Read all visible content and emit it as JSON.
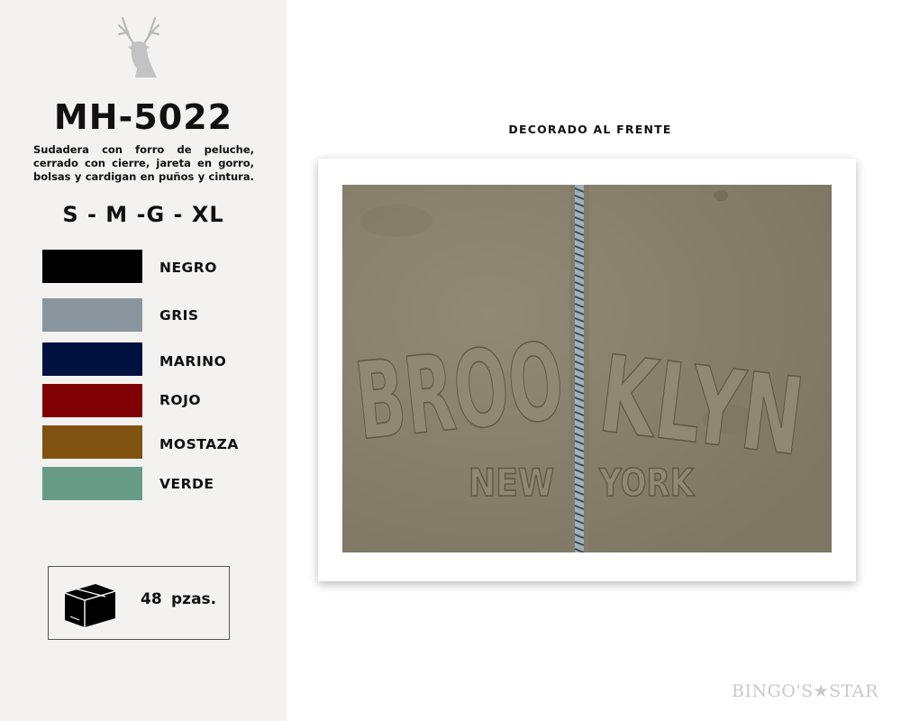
{
  "product": {
    "model": "MH-5022",
    "description": "Sudadera con forro de peluche, cerrado con cierre, jareta en gorro, bolsas y cardigan en puños y cintura.",
    "sizes": "S - M -G - XL"
  },
  "colors": [
    {
      "name": "NEGRO",
      "hex": "#000000"
    },
    {
      "name": "GRIS",
      "hex": "#8a959d"
    },
    {
      "name": "MARINO",
      "hex": "#011240"
    },
    {
      "name": "ROJO",
      "hex": "#800104"
    },
    {
      "name": "MOSTAZA",
      "hex": "#815311"
    },
    {
      "name": "VERDE",
      "hex": "#689b87"
    }
  ],
  "package": {
    "icon": "box-icon",
    "quantity": "48",
    "unit": "pzas."
  },
  "photo": {
    "label": "DECORADO AL FRENTE",
    "embossed_text_top": "BROOKLYN",
    "embossed_text_bottom": "NEW YORK",
    "fabric_color": "#8b8570"
  },
  "brand": {
    "logo_icon": "deer-head-icon",
    "name": "BINGO'S★STAR"
  }
}
